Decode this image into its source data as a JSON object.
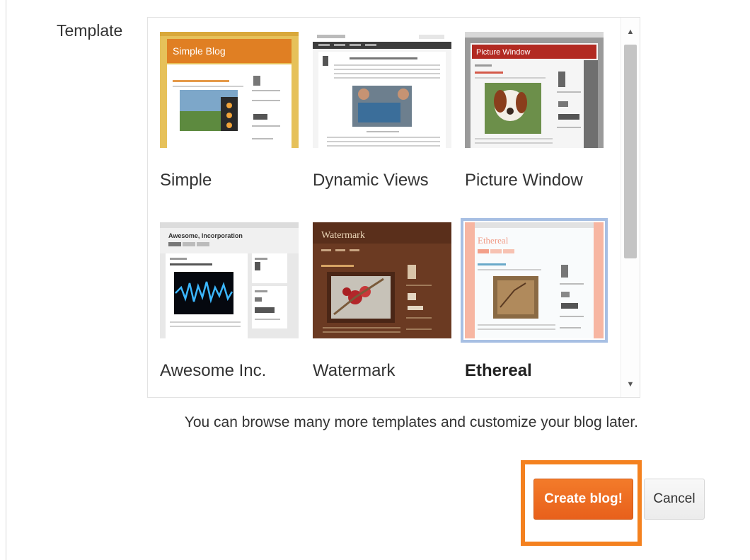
{
  "form": {
    "template_label": "Template",
    "hint": "You can browse many more templates and customize your blog later.",
    "create_label": "Create blog!",
    "cancel_label": "Cancel"
  },
  "templates": [
    {
      "name": "Simple",
      "thumb_title": "Simple Blog",
      "selected": false
    },
    {
      "name": "Dynamic Views",
      "thumb_title": "",
      "selected": false
    },
    {
      "name": "Picture Window",
      "thumb_title": "Picture Window",
      "selected": false
    },
    {
      "name": "Awesome Inc.",
      "thumb_title": "Awesome, Incorporation",
      "selected": false
    },
    {
      "name": "Watermark",
      "thumb_title": "Watermark",
      "selected": false
    },
    {
      "name": "Ethereal",
      "thumb_title": "Ethereal",
      "selected": true
    }
  ],
  "scrollbar": {
    "up_icon": "triangle-up-icon",
    "down_icon": "triangle-down-icon"
  },
  "colors": {
    "accent": "#f4811f",
    "selection": "#a7bfe3"
  }
}
